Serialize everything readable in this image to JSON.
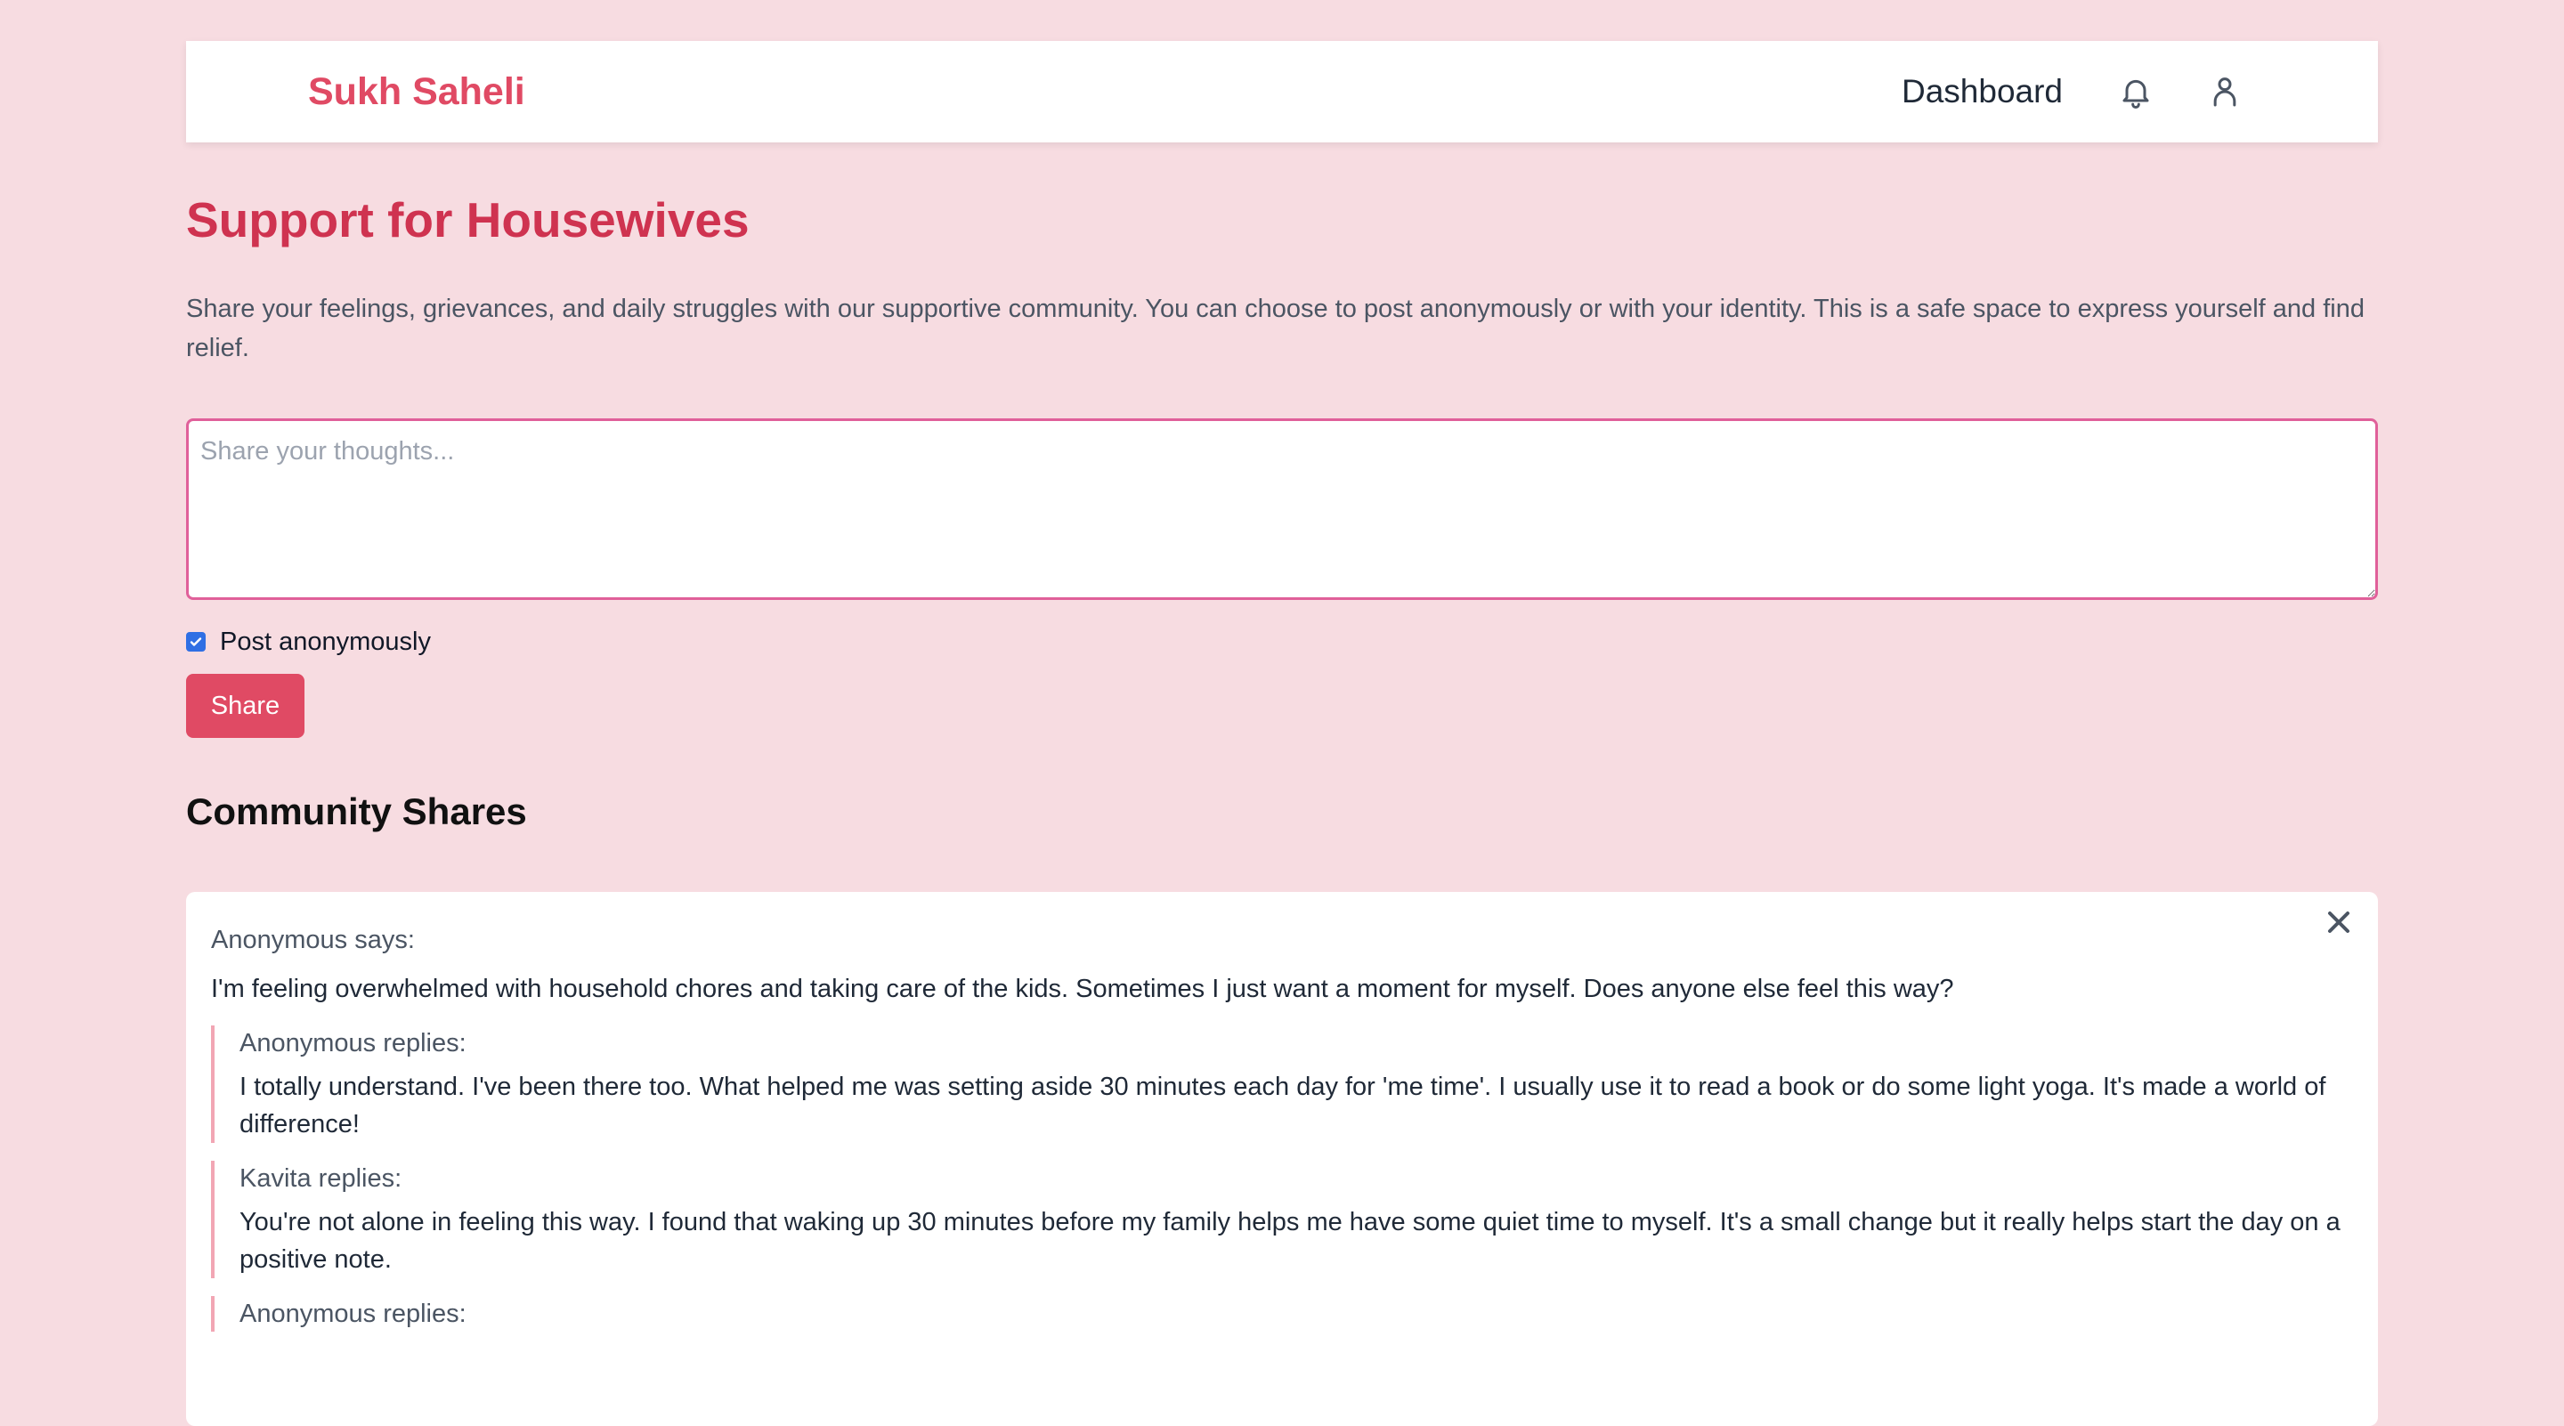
{
  "header": {
    "brand": "Sukh Saheli",
    "nav_link": "Dashboard",
    "icons": [
      "bell-icon",
      "user-icon"
    ]
  },
  "page": {
    "title": "Support for Housewives",
    "intro": "Share your feelings, grievances, and daily struggles with our supportive community. You can choose to post anonymously or with your identity. This is a safe space to express yourself and find relief."
  },
  "composer": {
    "placeholder": "Share your thoughts...",
    "value": "",
    "anonymous_label": "Post anonymously",
    "anonymous_checked": true,
    "share_label": "Share"
  },
  "community": {
    "heading": "Community Shares",
    "post": {
      "author": "Anonymous says:",
      "text": "I'm feeling overwhelmed with household chores and taking care of the kids. Sometimes I just want a moment for myself. Does anyone else feel this way?",
      "replies": [
        {
          "author": "Anonymous replies:",
          "text": "I totally understand. I've been there too. What helped me was setting aside 30 minutes each day for 'me time'. I usually use it to read a book or do some light yoga. It's made a world of difference!"
        },
        {
          "author": "Kavita replies:",
          "text": "You're not alone in feeling this way. I found that waking up 30 minutes before my family helps me have some quiet time to myself. It's a small change but it really helps start the day on a positive note."
        },
        {
          "author": "Anonymous replies:",
          "text": ""
        }
      ]
    }
  },
  "colors": {
    "background": "#f7dce1",
    "brand": "#e04a64",
    "title": "#cf3350",
    "accent_border": "#e0609a",
    "checkbox": "#2f6fe4"
  }
}
